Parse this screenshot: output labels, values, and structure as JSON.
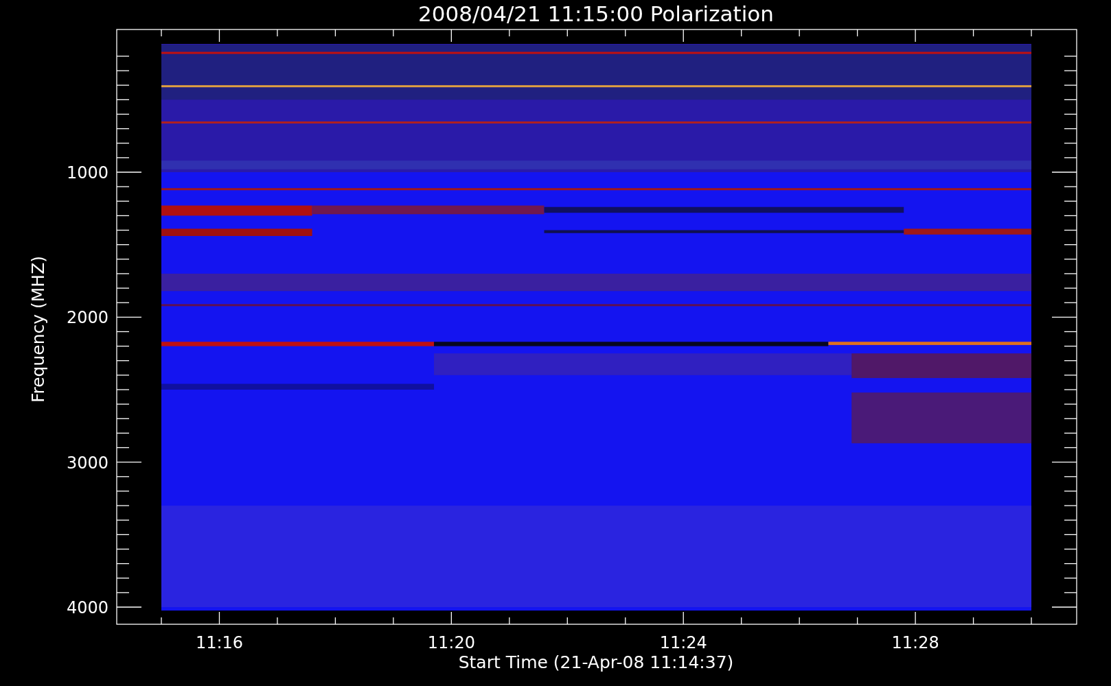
{
  "plot": {
    "title": "2008/04/21 11:15:00 Polarization",
    "ylabel": "Frequency (MHZ)",
    "xlabel": "Start Time (21-Apr-08 11:14:37)",
    "yticks": [
      "1000",
      "2000",
      "3000",
      "4000"
    ],
    "xticks": [
      "11:16",
      "11:20",
      "11:24",
      "11:28"
    ]
  }
}
